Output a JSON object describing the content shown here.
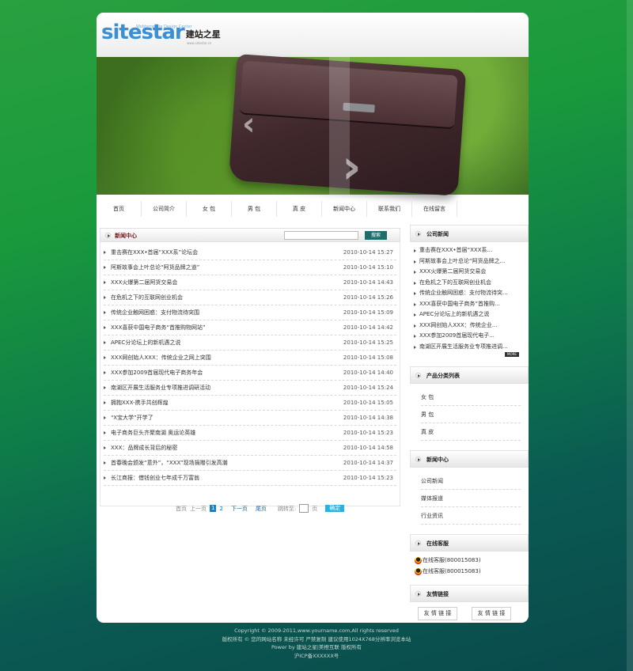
{
  "logo": {
    "main": "sitestar",
    "cn": "建站之星",
    "sub": "Webtemplate Design Center",
    "url": "www.sitestar.cn"
  },
  "nav": [
    "首页",
    "公司简介",
    "女 包",
    "男 包",
    "真 皮",
    "新闻中心",
    "联系我们",
    "在线留言"
  ],
  "news": {
    "title": "新闻中心",
    "search_btn": "搜索",
    "rows": [
      {
        "t": "重击赛在XXX•首届“XXX系”论坛会",
        "d": "2010-10-14 15:27"
      },
      {
        "t": "阿斯故事会上叶总论“阿货品牌之道”",
        "d": "2010-10-14 15:10"
      },
      {
        "t": "XXX火爆第二届阿货交易会",
        "d": "2010-10-14 14:43"
      },
      {
        "t": "在危机之下的互联网创业机会",
        "d": "2010-10-14 15:26"
      },
      {
        "t": "传统企业触网困惑：支付物流待突围",
        "d": "2010-10-14 15:09"
      },
      {
        "t": "XXX喜获中国电子商务“首推购物网站”",
        "d": "2010-10-14 14:42"
      },
      {
        "t": "APEC分论坛上的新机遇之说",
        "d": "2010-10-14 15:25"
      },
      {
        "t": "XXX网创始人XXX：传统企业之网上突围",
        "d": "2010-10-14 15:08"
      },
      {
        "t": "XXX参加2009首届现代电子商务年会",
        "d": "2010-10-14 14:40"
      },
      {
        "t": "南湖区开展生活服务业专项推进调研活动",
        "d": "2010-10-14 15:24"
      },
      {
        "t": "拥抱XXX-携手共创辉煌",
        "d": "2010-10-14 15:05"
      },
      {
        "t": "“X宝大学”开学了",
        "d": "2010-10-14 14:38"
      },
      {
        "t": "电子商务巨头齐聚南湖 奥运论英雄",
        "d": "2010-10-14 15:23"
      },
      {
        "t": "XXX：品牌成长背后的秘密",
        "d": "2010-10-14 14:58"
      },
      {
        "t": "首春晚会颁发“意外”，“XXX”现场捐赠引发高潮",
        "d": "2010-10-14 14:37"
      },
      {
        "t": "长江商报：借钱创业七年成千万富翁",
        "d": "2010-10-14 15:23"
      }
    ]
  },
  "pager": {
    "first": "首页",
    "prev": "上一页",
    "cur": "1",
    "page2": "2",
    "next": "下一页",
    "last": "尾页",
    "jump": "跳转至:",
    "page_unit": "页",
    "go": "确定"
  },
  "company_news": {
    "title": "公司新闻",
    "items": [
      "重击赛在XXX•首届“XXX系...",
      "阿斯故事会上叶总论“阿货品牌之...",
      "XXX火爆第二届阿货交易会",
      "在危机之下的互联网创业机会",
      "传统企业触网困惑：支付物流待突...",
      "XXX喜获中国电子商务“首推购...",
      "APEC分论坛上的新机遇之说",
      "XXX网创始人XXX：传统企业...",
      "XXX参加2009首届现代电子...",
      "南湖区开展生活服务业专项推进调..."
    ],
    "more": "MORE"
  },
  "categories": {
    "title": "产品分类列表",
    "items": [
      "女 包",
      "男 包",
      "真 皮"
    ]
  },
  "news_center": {
    "title": "新闻中心",
    "items": [
      "公司新闻",
      "媒体报道",
      "行业资讯"
    ]
  },
  "kefu": {
    "title": "在线客服",
    "items": [
      "在线客服(800015083)",
      "在线客服(800015083)"
    ]
  },
  "friend_links": {
    "title": "友情链接",
    "items": [
      "友 情 链 接",
      "友 情 链 接"
    ]
  },
  "footer": [
    "Copyright © 2009-2011,www.yourname.com,All rights reserved",
    "版权所有 © 您的网站名称 未经许可 严禁复制 建议使用1024X768分辨率浏览本站",
    "Power by 建站之星|美橙互联 版权所有",
    "沪ICP备XXXXXX号"
  ]
}
